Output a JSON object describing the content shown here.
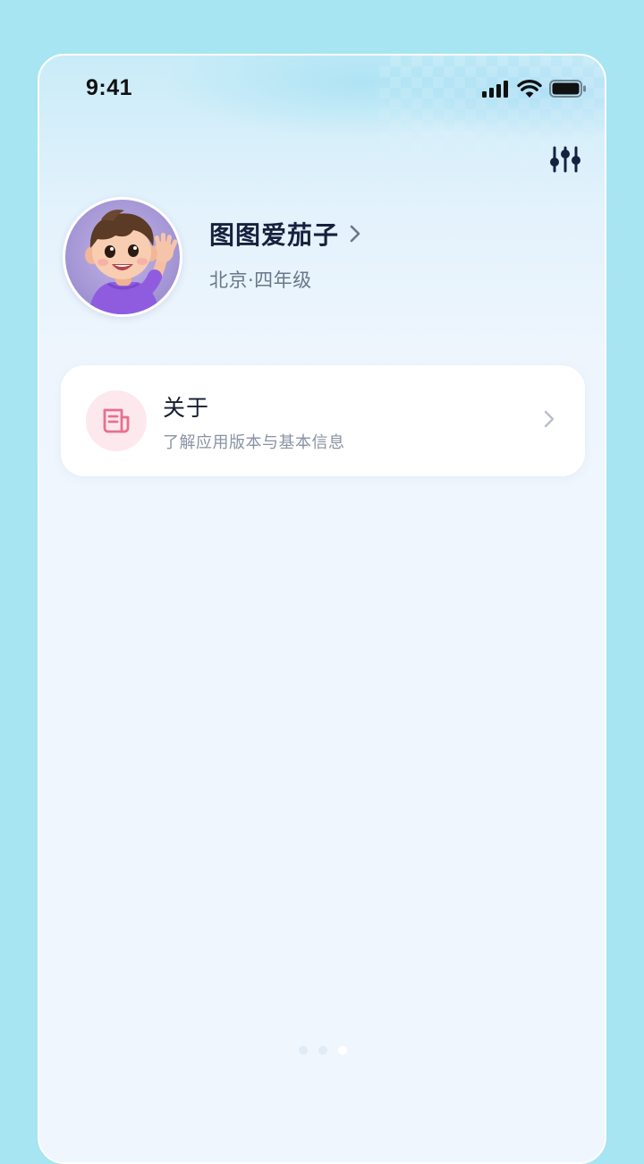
{
  "status_bar": {
    "time": "9:41"
  },
  "header": {
    "settings_icon": "sliders-icon"
  },
  "profile": {
    "name": "图图爱茄子",
    "subtitle": "北京·四年级",
    "avatar": "cartoon-boy-waving-avatar"
  },
  "menu": {
    "items": [
      {
        "title": "关于",
        "description": "了解应用版本与基本信息",
        "icon": "news-document-icon",
        "icon_color": "#e8708d",
        "icon_bg": "#fde8ee"
      }
    ]
  },
  "pager": {
    "count": 3,
    "active_index": 2
  },
  "colors": {
    "page_background": "#a6e5f1",
    "screen_background": "#f0f6fd",
    "title_text": "#16213e",
    "secondary_text": "#6b7689"
  }
}
